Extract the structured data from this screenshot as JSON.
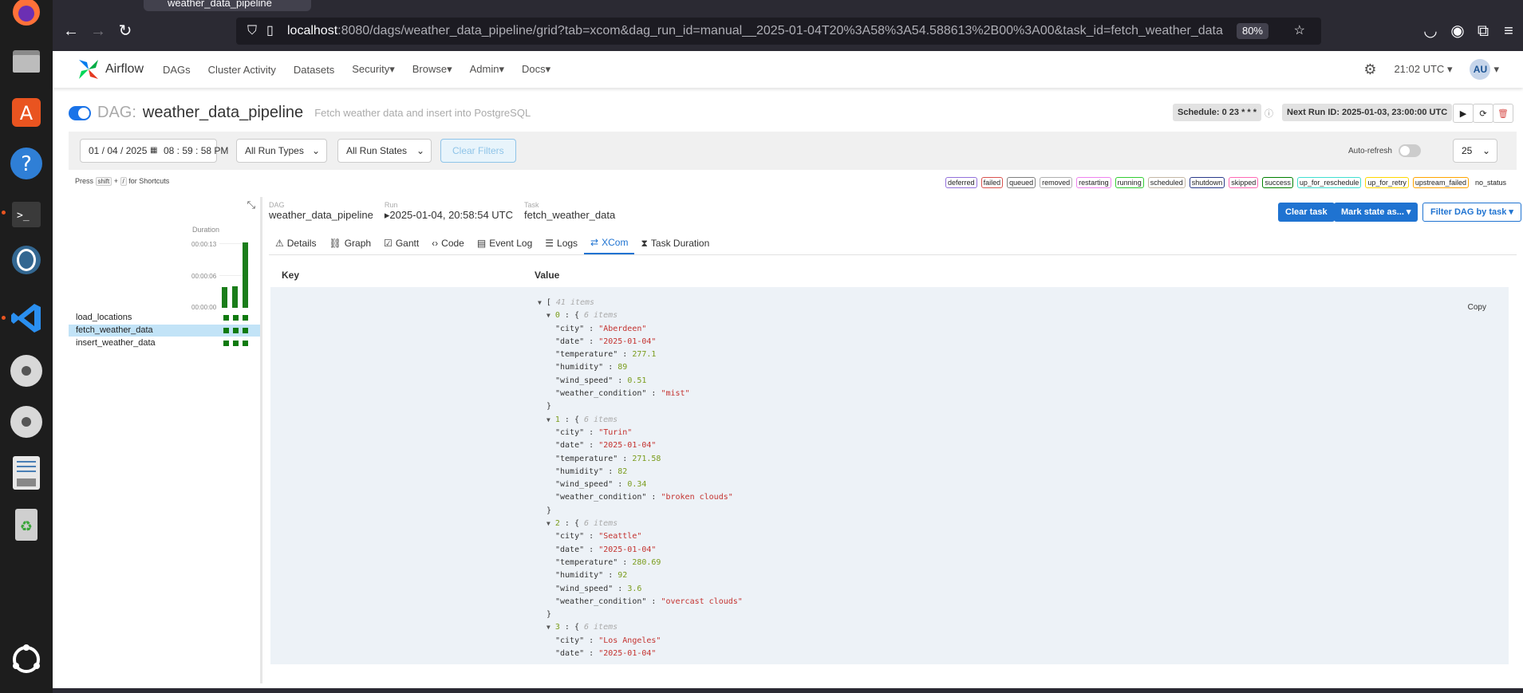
{
  "browser": {
    "tab_title": "weather_data_pipeline",
    "url_host": "localhost",
    "url_rest": ":8080/dags/weather_data_pipeline/grid?tab=xcom&dag_run_id=manual__2025-01-04T20%3A58%3A54.588613%2B00%3A00&task_id=fetch_weather_data",
    "zoom": "80%"
  },
  "nav": {
    "brand": "Airflow",
    "menu": [
      "DAGs",
      "Cluster Activity",
      "Datasets",
      "Security",
      "Browse",
      "Admin",
      "Docs"
    ],
    "time": "21:02 UTC",
    "avatar": "AU"
  },
  "dag": {
    "prefix": "DAG:",
    "id": "weather_data_pipeline",
    "description": "Fetch weather data and insert into PostgreSQL",
    "schedule": "Schedule: 0 23 * * *",
    "next_run": "Next Run ID: 2025-01-03, 23:00:00 UTC"
  },
  "filters": {
    "date": "01 / 04 / 2025",
    "time": "08 : 59 : 58  PM",
    "run_types": "All Run Types",
    "run_states": "All Run States",
    "clear": "Clear Filters",
    "autorefresh": "Auto-refresh",
    "num_runs": "25"
  },
  "shortcuts": {
    "press": "Press",
    "k1": "shift",
    "plus": "+",
    "k2": "/",
    "suffix": "for Shortcuts"
  },
  "legend": [
    {
      "label": "deferred",
      "color": "#9370db"
    },
    {
      "label": "failed",
      "color": "#d9534f"
    },
    {
      "label": "queued",
      "color": "#808080"
    },
    {
      "label": "removed",
      "color": "#b0b0b0"
    },
    {
      "label": "restarting",
      "color": "#ee82ee"
    },
    {
      "label": "running",
      "color": "#32cd32"
    },
    {
      "label": "scheduled",
      "color": "#c4b7a6"
    },
    {
      "label": "shutdown",
      "color": "#2a3a8a"
    },
    {
      "label": "skipped",
      "color": "#ff69b4"
    },
    {
      "label": "success",
      "color": "#008000"
    },
    {
      "label": "up_for_reschedule",
      "color": "#40e0d0"
    },
    {
      "label": "up_for_retry",
      "color": "#ffd700"
    },
    {
      "label": "upstream_failed",
      "color": "#ffa500"
    },
    {
      "label": "no_status",
      "color": "#ffffff"
    }
  ],
  "grid": {
    "duration_label": "Duration",
    "ticks": [
      "00:00:13",
      "00:00:06",
      "00:00:00"
    ],
    "tasks": [
      "load_locations",
      "fetch_weather_data",
      "insert_weather_data"
    ]
  },
  "breadcrumb": {
    "dag_label": "DAG",
    "dag": "weather_data_pipeline",
    "run_label": "Run",
    "run": "2025-01-04, 20:58:54 UTC",
    "task_label": "Task",
    "task": "fetch_weather_data"
  },
  "actions": {
    "clear_task": "Clear task",
    "mark_state": "Mark state as...",
    "filter": "Filter DAG by task"
  },
  "tabs": [
    {
      "icon": "⚠",
      "label": "Details"
    },
    {
      "icon": "⛓",
      "label": "Graph"
    },
    {
      "icon": "☑",
      "label": "Gantt"
    },
    {
      "icon": "‹›",
      "label": "Code"
    },
    {
      "icon": "▤",
      "label": "Event Log"
    },
    {
      "icon": "☰",
      "label": "Logs"
    },
    {
      "icon": "⇄",
      "label": "XCom"
    },
    {
      "icon": "⧗",
      "label": "Task Duration"
    }
  ],
  "xcom": {
    "key_header": "Key",
    "value_header": "Value",
    "copy": "Copy",
    "count": "41 items",
    "item_count": "6 items",
    "items": [
      {
        "city": "Aberdeen",
        "date": "2025-01-04",
        "temperature": "277.1",
        "humidity": "89",
        "wind_speed": "0.51",
        "weather_condition": "mist"
      },
      {
        "city": "Turin",
        "date": "2025-01-04",
        "temperature": "271.58",
        "humidity": "82",
        "wind_speed": "0.34",
        "weather_condition": "broken clouds"
      },
      {
        "city": "Seattle",
        "date": "2025-01-04",
        "temperature": "280.69",
        "humidity": "92",
        "wind_speed": "3.6",
        "weather_condition": "overcast clouds"
      },
      {
        "city": "Los Angeles",
        "date": "2025-01-04"
      }
    ]
  }
}
